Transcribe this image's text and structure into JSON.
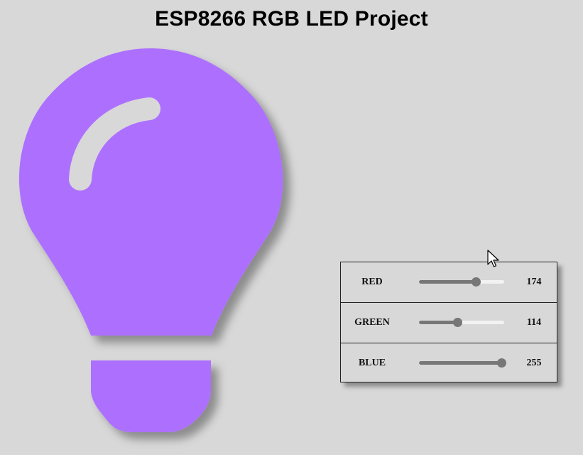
{
  "page": {
    "title": "ESP8266 RGB LED Project"
  },
  "bulb": {
    "icon": "lightbulb-icon",
    "color": "#ad70fe",
    "highlight_color": "#d8d8d8"
  },
  "controls": [
    {
      "id": "red",
      "label": "RED",
      "value": 174,
      "max": 255,
      "value_text": "174"
    },
    {
      "id": "green",
      "label": "GREEN",
      "value": 114,
      "max": 255,
      "value_text": "114"
    },
    {
      "id": "blue",
      "label": "BLUE",
      "value": 255,
      "max": 255,
      "value_text": "255"
    }
  ],
  "colors": {
    "background": "#d8d8d8",
    "slider_fill": "#777777",
    "slider_track": "#f2f2f2"
  }
}
